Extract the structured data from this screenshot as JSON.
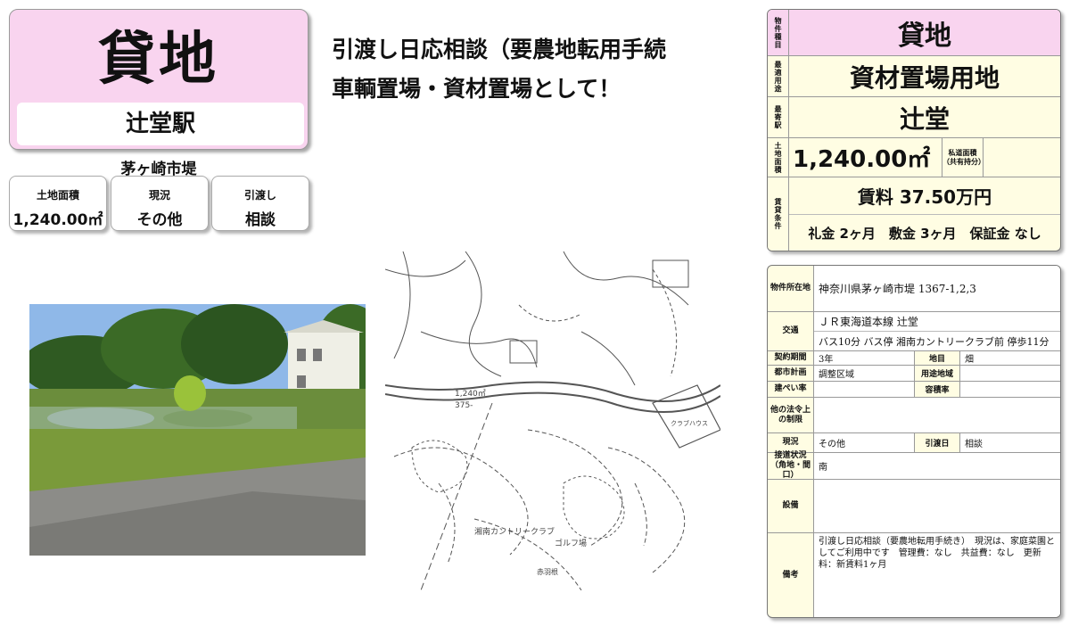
{
  "title_card": {
    "title": "貸地",
    "station": "辻堂駅"
  },
  "area": "茅ヶ崎市堤",
  "info_boxes": [
    {
      "label": "土地面積",
      "value": "1,240.00㎡"
    },
    {
      "label": "現況",
      "value": "その他"
    },
    {
      "label": "引渡し",
      "value": "相談"
    }
  ],
  "headline": [
    "引渡し日応相談（要農地転用手続",
    "車輌置場・資材置場として！"
  ],
  "map": {
    "label_country_club": "湘南カントリークラブ",
    "label_golf": "ゴルフ場",
    "label_club_house": "クラブハウス",
    "label_area_note": "1,240㎡",
    "label_lot": "375-",
    "label_shrine": "赤羽根"
  },
  "summary": {
    "type_label": "物件種目",
    "type_value": "貸地",
    "use_label": "最適用途",
    "use_value": "資材置場用地",
    "station_label": "最寄駅",
    "station_value": "辻堂",
    "land_label": "土地面積",
    "land_value": "1,240.00㎡",
    "private_road_label": "私道面積（共有持分）",
    "rent_label": "賃貸条件",
    "rent_line": "賃料 37.50万円",
    "terms": "礼金 2ヶ月　敷金 3ヶ月　保証金 なし"
  },
  "detail": {
    "address_label": "物件所在地",
    "address_value": "神奈川県茅ヶ崎市堤 1367-1,2,3",
    "transport_label": "交通",
    "transport_line1": "ＪＲ東海道本線 辻堂",
    "transport_line2": "バス10分 バス停 湘南カントリークラブ前 停歩11分",
    "contract_label": "契約期間",
    "contract_value": "3年",
    "landcat_label": "地目",
    "landcat_value": "畑",
    "city_plan_label": "都市計画",
    "city_plan_value": "調整区域",
    "zoning_label": "用途地域",
    "zoning_value": "",
    "bcr_label": "建ぺい率",
    "bcr_value": "",
    "far_label": "容積率",
    "far_value": "",
    "other_law_label": "他の法令上の制限",
    "other_law_value": "",
    "status_label": "現況",
    "status_value": "その他",
    "handover_label": "引渡日",
    "handover_value": "相談",
    "road_label": "接道状況（角地・間口）",
    "road_value": "南",
    "facility_label": "設備",
    "facility_value": "",
    "remarks_label": "備考",
    "remarks_value": "引渡し日応相談（要農地転用手続き）　現況は、家庭菜園としてご利用中です　管理費：なし　共益費：なし　更新料：新賃料1ヶ月"
  },
  "colors": {
    "title_bg": "#f9d4ef",
    "table_label_bg": "#fffde3",
    "summary_type_bg": "#f9d4ef"
  }
}
